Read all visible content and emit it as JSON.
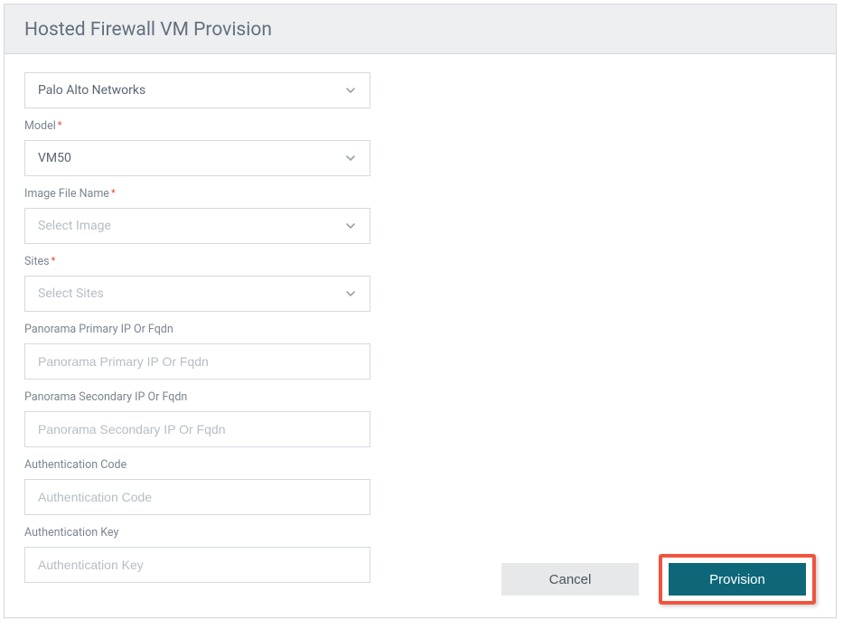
{
  "header": {
    "title": "Hosted Firewall VM Provision"
  },
  "form": {
    "vendor": {
      "value": "Palo Alto Networks"
    },
    "model": {
      "label": "Model",
      "value": "VM50"
    },
    "image": {
      "label": "Image File Name",
      "placeholder": "Select Image"
    },
    "sites": {
      "label": "Sites",
      "placeholder": "Select Sites"
    },
    "panoramaPrimary": {
      "label": "Panorama Primary IP Or Fqdn",
      "placeholder": "Panorama Primary IP Or Fqdn"
    },
    "panoramaSecondary": {
      "label": "Panorama Secondary IP Or Fqdn",
      "placeholder": "Panorama Secondary IP Or Fqdn"
    },
    "authCode": {
      "label": "Authentication Code",
      "placeholder": "Authentication Code"
    },
    "authKey": {
      "label": "Authentication Key",
      "placeholder": "Authentication Key"
    }
  },
  "buttons": {
    "cancel": "Cancel",
    "provision": "Provision"
  }
}
